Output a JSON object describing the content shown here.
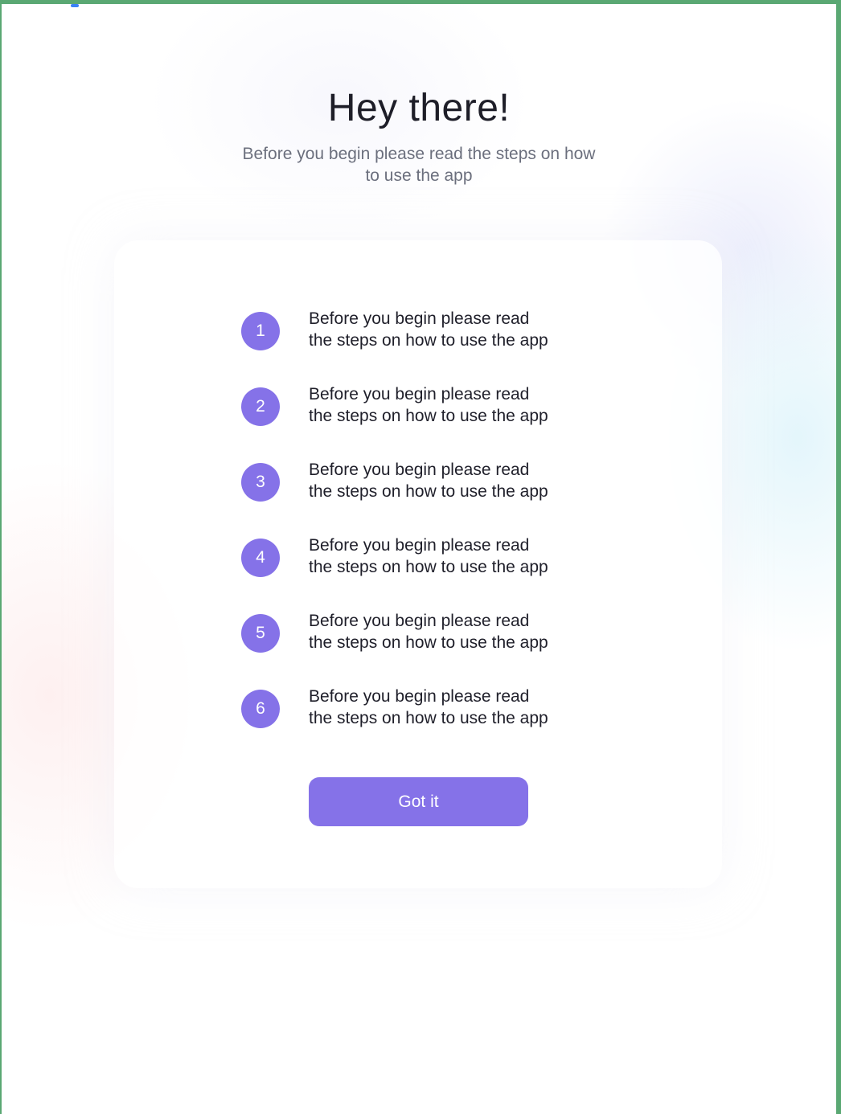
{
  "header": {
    "title": "Hey there!",
    "subtitle": "Before you begin please read the steps on how to use the app"
  },
  "steps": [
    {
      "number": "1",
      "text_line1": "Before you begin please read",
      "text_line2": "the steps on how to use the app"
    },
    {
      "number": "2",
      "text_line1": "Before you begin please read",
      "text_line2": "the steps on how to use the app"
    },
    {
      "number": "3",
      "text_line1": "Before you begin please read",
      "text_line2": "the steps on how to use the app"
    },
    {
      "number": "4",
      "text_line1": "Before you begin please read",
      "text_line2": "the steps on how to use the app"
    },
    {
      "number": "5",
      "text_line1": "Before you begin please read",
      "text_line2": "the steps on how to use the app"
    },
    {
      "number": "6",
      "text_line1": "Before you begin please read",
      "text_line2": "the steps on how to use the app"
    }
  ],
  "actions": {
    "confirm_label": "Got it"
  },
  "colors": {
    "accent": "#8572e8",
    "frame_border": "#5aa873",
    "text_primary": "#1f1f2a",
    "text_secondary": "#6b6f7d"
  }
}
